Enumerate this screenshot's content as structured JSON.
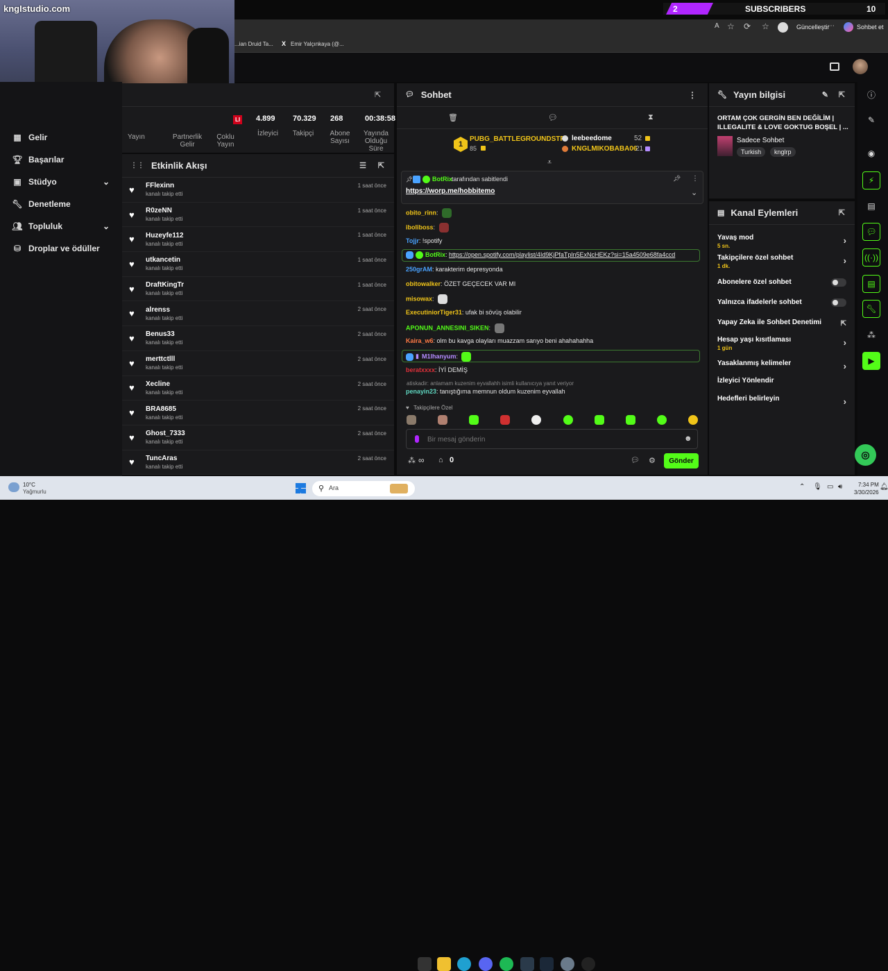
{
  "overlay": {
    "watermark": "kngIstudio.com",
    "sub_count": "2",
    "sub_label": "SUBSCRIBERS",
    "sub_goal": "10"
  },
  "browser": {
    "update_label": "Güncelleştir",
    "sohbet_label": "Sohbet et",
    "bookmarks": [
      "...ian Druid Ta...",
      "Emir Yalçınkaya (@..."
    ]
  },
  "sidebar": {
    "items": [
      {
        "label": "Gelir",
        "icon": "chart-icon"
      },
      {
        "label": "Başarılar",
        "icon": "trophy-icon"
      },
      {
        "label": "Stüdyo",
        "icon": "studio-icon",
        "expandable": true
      },
      {
        "label": "Denetleme",
        "icon": "wrench-icon"
      },
      {
        "label": "Topluluk",
        "icon": "community-icon",
        "expandable": true
      },
      {
        "label": "Droplar ve ödüller",
        "icon": "drops-icon"
      }
    ]
  },
  "stats": {
    "live_badge": "LI",
    "items": [
      {
        "label": "Yayın",
        "value": ""
      },
      {
        "label": "Partnerlik Gelir",
        "value": ""
      },
      {
        "label": "Çoklu Yayın",
        "value": ""
      },
      {
        "label": "İzleyici",
        "value": "4.899"
      },
      {
        "label": "Takipçi",
        "value": "70.329"
      },
      {
        "label": "Abone Sayısı",
        "value": "268"
      },
      {
        "label": "Yayında Olduğu Süre",
        "value": "00:38:58"
      }
    ]
  },
  "activity": {
    "title": "Etkinlik Akışı",
    "events": [
      {
        "name": "FFlexinn",
        "action": "kanalı takip etti",
        "time": "1 saat önce"
      },
      {
        "name": "R0zeNN",
        "action": "kanalı takip etti",
        "time": "1 saat önce"
      },
      {
        "name": "Huzeyfe112",
        "action": "kanalı takip etti",
        "time": "1 saat önce"
      },
      {
        "name": "utkancetin",
        "action": "kanalı takip etti",
        "time": "1 saat önce"
      },
      {
        "name": "DraftKingTr",
        "action": "kanalı takip etti",
        "time": "1 saat önce"
      },
      {
        "name": "alrenss",
        "action": "kanalı takip etti",
        "time": "2 saat önce"
      },
      {
        "name": "Benus33",
        "action": "kanalı takip etti",
        "time": "2 saat önce"
      },
      {
        "name": "merttctlll",
        "action": "kanalı takip etti",
        "time": "2 saat önce"
      },
      {
        "name": "Xecline",
        "action": "kanalı takip etti",
        "time": "2 saat önce"
      },
      {
        "name": "BRA8685",
        "action": "kanalı takip etti",
        "time": "2 saat önce"
      },
      {
        "name": "Ghost_7333",
        "action": "kanalı takip etti",
        "time": "2 saat önce"
      },
      {
        "name": "TuncAras",
        "action": "kanalı takip etti",
        "time": "2 saat önce"
      }
    ]
  },
  "chat": {
    "title": "Sohbet",
    "leaderboard": {
      "first": {
        "rank": "1",
        "name": "PUBG_BATTLEGROUNDSTR",
        "points": "85"
      },
      "second": {
        "name": "leebeedome",
        "points": "52"
      },
      "third": {
        "name": "KNGLMIKOBABA06",
        "points": "21"
      }
    },
    "pinned": {
      "by_user": "BotRix",
      "by_text": "tarafından sabitlendi",
      "link": "https://worp.me/hobbitemo"
    },
    "messages": [
      {
        "user": "obito_rinn",
        "color": "#f0c419",
        "text": ""
      },
      {
        "user": "iboliboss",
        "color": "#f0c419",
        "text": ""
      },
      {
        "user": "Tojjr",
        "color": "#4aa3ff",
        "text": "!spotify"
      },
      {
        "user": "BotRix",
        "color": "#53fc18",
        "text": "https://open.spotify.com/playlist/4Id9KjPfaTpln5ExNcHEKz?si=15a4509e68fa4ccd"
      },
      {
        "user": "250grAM",
        "color": "#4aa3ff",
        "text": "karakterim depresyonda"
      },
      {
        "user": "obitowalker",
        "color": "#f0c419",
        "text": "ÖZET GEÇECEK VAR MI"
      },
      {
        "user": "misowax",
        "color": "#f0c419",
        "text": ""
      },
      {
        "user": "ExecutiniorTiger31",
        "color": "#f0c419",
        "text": "ufak bi sövüş olabilir"
      },
      {
        "user": "APONUN_ANNESINI_SIKEN",
        "color": "#53fc18",
        "text": ""
      },
      {
        "user": "Kaira_w6",
        "color": "#ff7a45",
        "text": "olm bu kavga olayları muazzam sarıyo beni ahahahahha"
      },
      {
        "user": "M1lhanyum",
        "color": "#b48cff",
        "text": ""
      },
      {
        "user": "beratxxxx",
        "color": "#e0303a",
        "text": "İYİ DEMİŞ"
      },
      {
        "user": "penayin23",
        "color": "#5fd6c0",
        "text": "tanıştığıma memnun oldum kuzenim eyvallah"
      }
    ],
    "reply_hint": "atiskadir: anlamam kuzenim eyvallahh isimli kullanıcıya yanıt veriyor",
    "followers_only": "Takipçilere Özel",
    "placeholder": "Bir mesaj gönderin",
    "points": "0",
    "send_label": "Gönder",
    "infinity": "∞"
  },
  "stream_info": {
    "title": "Yayın bilgisi",
    "stream_title": "ORTAM ÇOK GERGİN BEN DEĞİLİM | ILLEGALITE & LOVE GOKTUG BOŞEL | ...",
    "category": "Sadece Sohbet",
    "tags": [
      "Turkish",
      "knglrp"
    ]
  },
  "channel_actions": {
    "title": "Kanal Eylemleri",
    "items": [
      {
        "label": "Yavaş mod",
        "sub": "5 sn.",
        "type": "chevron"
      },
      {
        "label": "Takipçilere özel sohbet",
        "sub": "1 dk.",
        "type": "chevron"
      },
      {
        "label": "Abonelere özel sohbet",
        "sub": "",
        "type": "toggle"
      },
      {
        "label": "Yalnızca ifadelerle sohbet",
        "sub": "",
        "type": "toggle"
      },
      {
        "label": "Yapay Zeka ile Sohbet Denetimi",
        "sub": "",
        "type": "external"
      },
      {
        "label": "Hesap yaşı kısıtlaması",
        "sub": "1 gün",
        "type": "chevron"
      },
      {
        "label": "Yasaklanmış kelimeler",
        "sub": "",
        "type": "chevron"
      },
      {
        "label": "İzleyici Yönlendir",
        "sub": "",
        "type": "none"
      },
      {
        "label": "Hedefleri belirleyin",
        "sub": "",
        "type": "chevron"
      }
    ]
  },
  "taskbar": {
    "weather_temp": "10°C",
    "weather_desc": "Yağmurlu",
    "search": "Ara",
    "time": "7:34 PM",
    "date": "3/30/2026"
  },
  "colors": {
    "accent": "#53fc18",
    "sub_pink": "#b026ff"
  }
}
